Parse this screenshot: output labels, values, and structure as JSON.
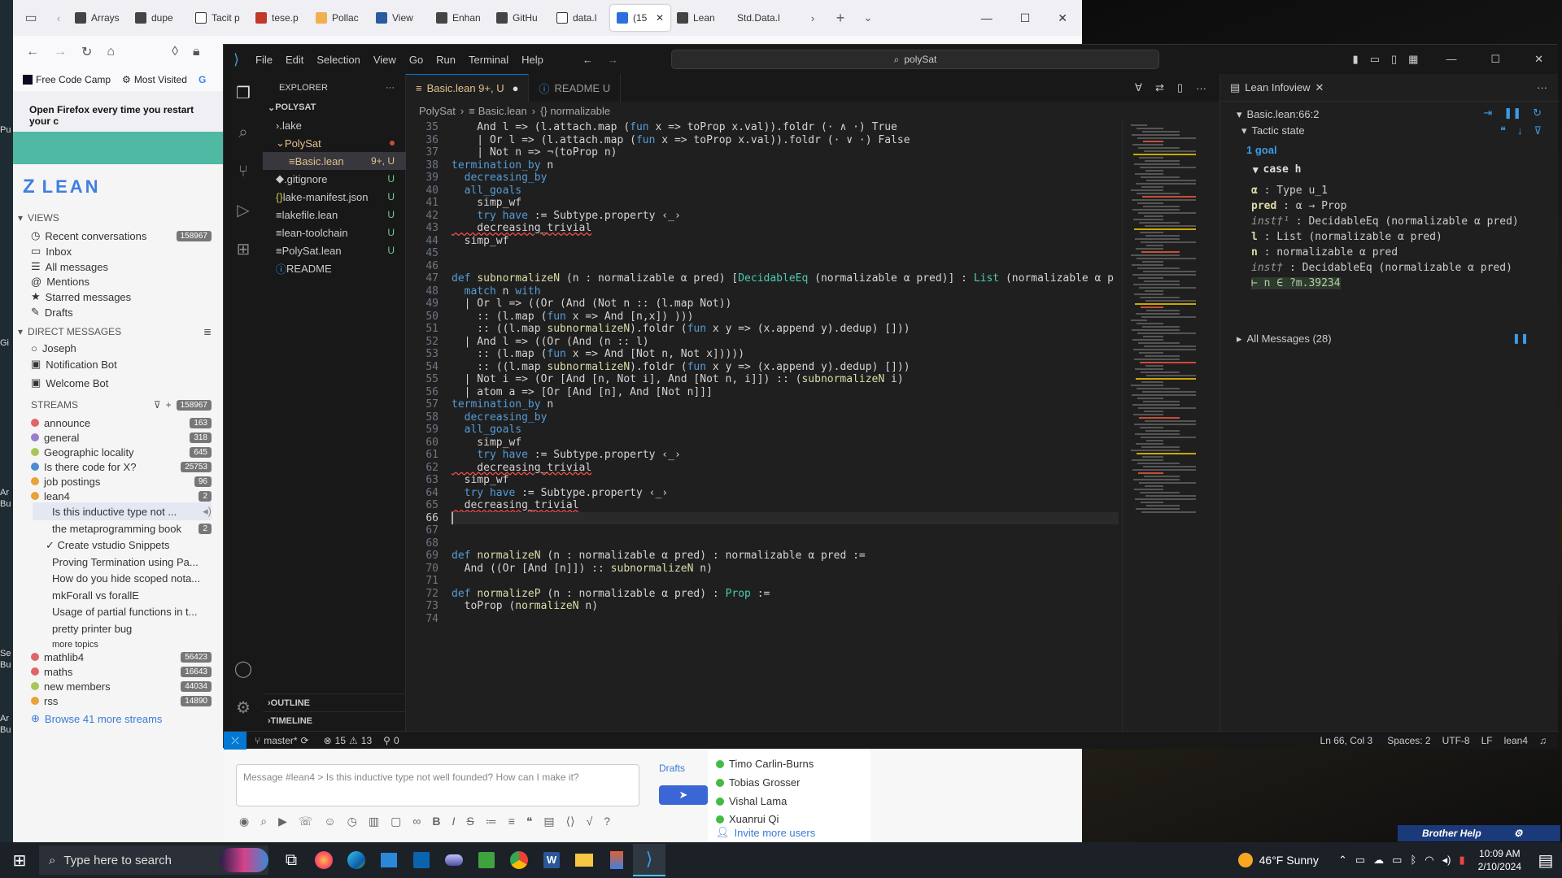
{
  "desktop": {
    "left_strip": [
      "Pu",
      "Gi",
      "Ar",
      "Bu",
      "Se",
      "Bu",
      "Ar",
      "Bu"
    ]
  },
  "browser": {
    "tabs": [
      "Arrays",
      "dupe",
      "Tacit p",
      "tese.p",
      "Pollac",
      "View",
      "Enhan",
      "GitHu",
      "data.l",
      "(15",
      "Lean",
      "Std.Data.l"
    ],
    "bookmarks": [
      "Free Code Camp",
      "Most Visited",
      "G"
    ],
    "notice": "Open Firefox every time you restart your c"
  },
  "zulip": {
    "logo": "LEAN",
    "views_title": "VIEWS",
    "views": [
      {
        "label": "Recent conversations",
        "count": "158967"
      },
      {
        "label": "Inbox"
      },
      {
        "label": "All messages"
      },
      {
        "label": "Mentions"
      },
      {
        "label": "Starred messages"
      },
      {
        "label": "Drafts"
      }
    ],
    "dm_title": "DIRECT MESSAGES",
    "dms": [
      "Joseph",
      "Notification Bot",
      "Welcome Bot"
    ],
    "streams_title": "STREAMS",
    "streams_count": "158967",
    "streams": [
      {
        "label": "announce",
        "count": "163",
        "color": "#e06666"
      },
      {
        "label": "general",
        "count": "318",
        "color": "#9a7ecc"
      },
      {
        "label": "Geographic locality",
        "count": "645",
        "color": "#a8c55b"
      },
      {
        "label": "Is there code for X?",
        "count": "25753",
        "color": "#4f8bcd"
      },
      {
        "label": "job postings",
        "count": "96",
        "color": "#e8a23a"
      },
      {
        "label": "lean4",
        "count": "2",
        "color": "#e8a23a"
      }
    ],
    "topics": [
      {
        "label": "Is this inductive type not ...",
        "count": ""
      },
      {
        "label": "the metaprogramming book",
        "count": "2"
      },
      {
        "label": "✓ Create vstudio Snippets",
        "count": ""
      },
      {
        "label": "Proving Termination using Pa...",
        "count": ""
      },
      {
        "label": "How do you hide scoped nota...",
        "count": ""
      },
      {
        "label": "mkForall vs forallE",
        "count": ""
      },
      {
        "label": "Usage of partial functions in t...",
        "count": ""
      },
      {
        "label": "pretty printer bug",
        "count": ""
      }
    ],
    "more_topics": "more topics",
    "streams2": [
      {
        "label": "mathlib4",
        "count": "56423",
        "color": "#e06666"
      },
      {
        "label": "maths",
        "count": "16643",
        "color": "#e06666"
      },
      {
        "label": "new members",
        "count": "44034",
        "color": "#a8c55b"
      },
      {
        "label": "rss",
        "count": "14890",
        "color": "#e8a23a"
      }
    ],
    "browse": "Browse 41 more streams",
    "compose_placeholder": "Message #lean4 > Is this inductive type not well founded? How can I make it?",
    "drafts": "Drafts",
    "users": [
      "Timo Carlin-Burns",
      "Tobias Grosser",
      "Vishal Lama",
      "Xuanrui Qi"
    ],
    "invite": "Invite more users",
    "brother_help": "Brother Help"
  },
  "vscode": {
    "menus": [
      "File",
      "Edit",
      "Selection",
      "View",
      "Go",
      "Run",
      "Terminal",
      "Help"
    ],
    "search": "polySat",
    "explorer_title": "EXPLORER",
    "project": "POLYSAT",
    "files": [
      {
        "name": ".lake",
        "badge": ""
      },
      {
        "name": "PolySat",
        "badge": ""
      },
      {
        "name": "Basic.lean",
        "badge": "9+, U"
      },
      {
        "name": ".gitignore",
        "badge": "U"
      },
      {
        "name": "lake-manifest.json",
        "badge": "U"
      },
      {
        "name": "lakefile.lean",
        "badge": "U"
      },
      {
        "name": "lean-toolchain",
        "badge": "U"
      },
      {
        "name": "PolySat.lean",
        "badge": "U"
      },
      {
        "name": "README",
        "badge": "U"
      }
    ],
    "outline": "OUTLINE",
    "timeline": "TIMELINE",
    "tabs": [
      {
        "label": "Basic.lean 9+, U"
      },
      {
        "label": "README U"
      }
    ],
    "breadcrumb": [
      "PolySat",
      "Basic.lean",
      "{} normalizable"
    ],
    "first_line": 35,
    "code": [
      "    And l => (l.attach.map (fun x => toProp x.val)).foldr (· ∧ ·) True",
      "    | Or l => (l.attach.map (fun x => toProp x.val)).foldr (· ∨ ·) False",
      "    | Not n => ¬(toProp n)",
      "termination_by n",
      "  decreasing_by",
      "  all_goals",
      "    simp_wf",
      "    try have := Subtype.property ‹_›",
      "    decreasing_trivial",
      "  simp_wf",
      "",
      "",
      "def subnormalizeN (n : normalizable α pred) [DecidableEq (normalizable α pred)] : List (normalizable α p",
      "  match n with",
      "  | Or l => ((Or (And (Not n :: (l.map Not))",
      "    :: (l.map (fun x => And [n,x]) )))",
      "    :: ((l.map subnormalizeN).foldr (fun x y => (x.append y).dedup) []))",
      "  | And l => ((Or (And (n :: l)",
      "    :: (l.map (fun x => And [Not n, Not x]))))",
      "    :: ((l.map subnormalizeN).foldr (fun x y => (x.append y).dedup) []))",
      "  | Not i => (Or [And [n, Not i], And [Not n, i]]) :: (subnormalizeN i)",
      "  | atom a => [Or [And [n], And [Not n]]]",
      "termination_by n",
      "  decreasing_by",
      "  all_goals",
      "    simp_wf",
      "    try have := Subtype.property ‹_›",
      "    decreasing_trivial",
      "  simp_wf",
      "  try have := Subtype.property ‹_›",
      "  decreasing_trivial",
      "  ",
      "",
      "",
      "def normalizeN (n : normalizable α pred) : normalizable α pred :=",
      "  And ((Or [And [n]]) :: subnormalizeN n)",
      "",
      "def normalizeP (n : normalizable α pred) : Prop :=",
      "  toProp (normalizeN n)",
      ""
    ],
    "current_line": 66,
    "infoview": {
      "title": "Lean Infoview",
      "location": "Basic.lean:66:2",
      "tactic_state": "Tactic state",
      "goals": "1 goal",
      "case": "case h",
      "hyps": [
        {
          "name": "α",
          "type": ": Type u_1"
        },
        {
          "name": "pred",
          "type": ": α → Prop"
        },
        {
          "name": "inst†¹",
          "type": ": DecidableEq (normalizable α pred)"
        },
        {
          "name": "l",
          "type": ": List (normalizable α pred)"
        },
        {
          "name": "n",
          "type": ": normalizable α pred"
        },
        {
          "name": "inst†",
          "type": ": DecidableEq (normalizable α pred)"
        }
      ],
      "goal": "⊢ n ∈ ?m.39234",
      "all_messages": "All Messages (28)"
    },
    "status": {
      "branch": "master*",
      "errors": "15",
      "warnings": "13",
      "ports": "0",
      "position": "Ln 66, Col 3",
      "spaces": "Spaces: 2",
      "encoding": "UTF-8",
      "eol": "LF",
      "language": "lean4"
    }
  },
  "taskbar": {
    "search": "Type here to search",
    "weather": "46°F  Sunny",
    "time": "10:09 AM",
    "date": "2/10/2024"
  }
}
